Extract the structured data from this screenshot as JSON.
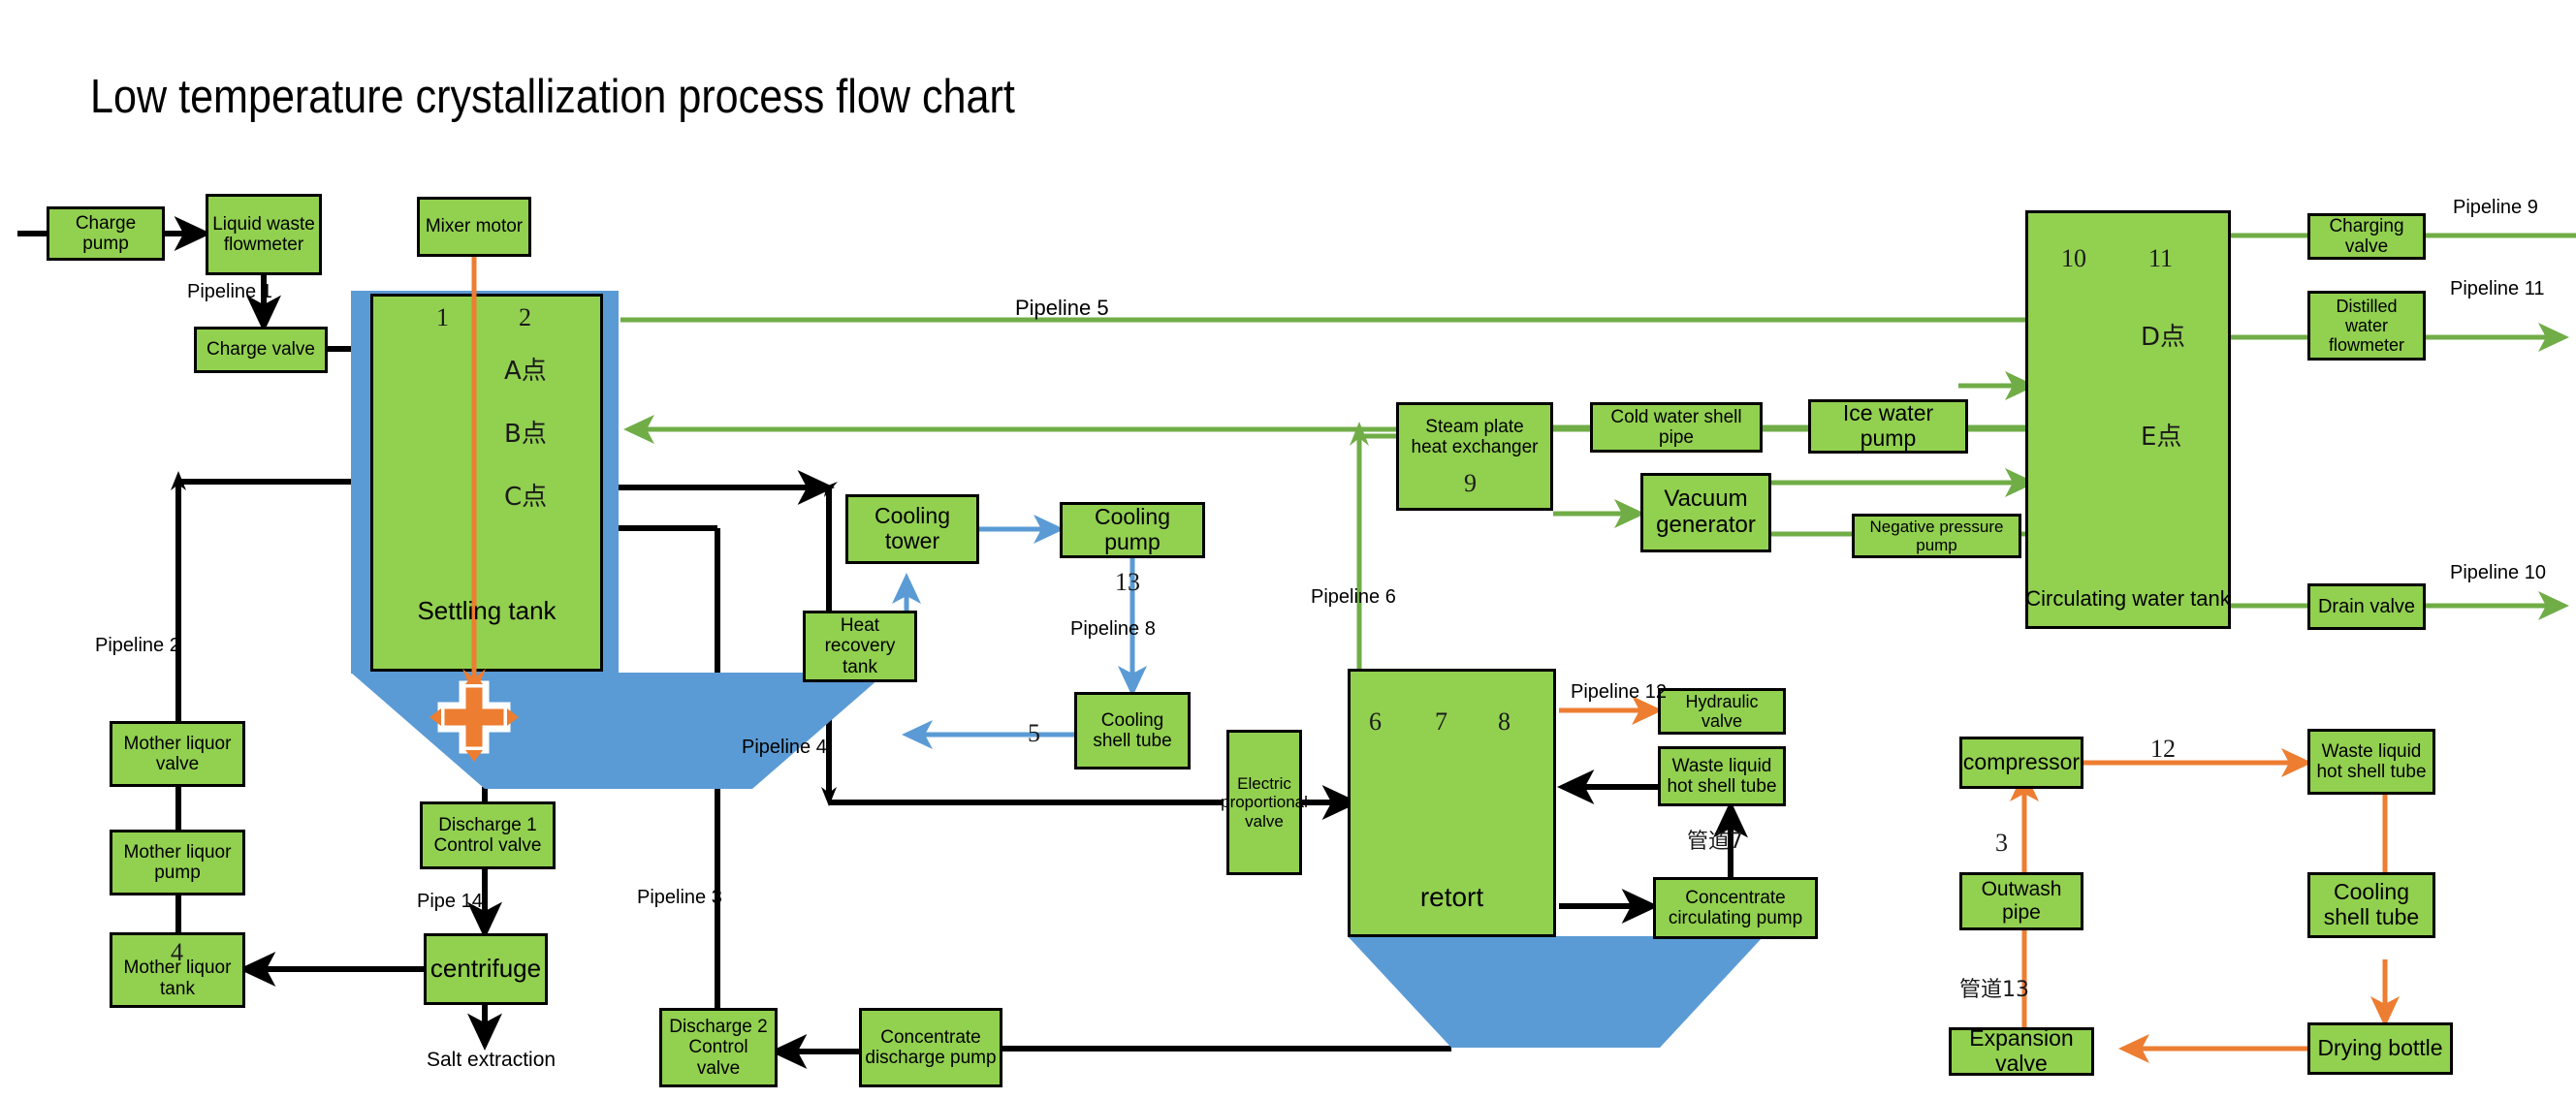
{
  "title": "Low temperature crystallization process flow chart",
  "colors": {
    "box_fill": "#92d050",
    "box_border": "#000000",
    "tank_shell": "#5b9bd5",
    "black_pipe": "#000000",
    "green_pipe": "#70ad47",
    "blue_pipe": "#5b9bd5",
    "orange_pipe": "#ed7d31",
    "background": "#ffffff"
  },
  "boxes": [
    {
      "id": "charge-pump",
      "label": "Charge pump"
    },
    {
      "id": "liquid-waste-flowmeter",
      "label": "Liquid  waste\nflowmeter"
    },
    {
      "id": "mixer-motor",
      "label": "Mixer motor"
    },
    {
      "id": "charge-valve",
      "label": "Charge valve"
    },
    {
      "id": "mother-liquor-valve",
      "label": "Mother liquor valve"
    },
    {
      "id": "mother-liquor-pump",
      "label": "Mother liquor pump"
    },
    {
      "id": "mother-liquor-tank",
      "label": "Mother liquor tank"
    },
    {
      "id": "discharge-1-control-valve",
      "label": "Discharge 1\nControl valve"
    },
    {
      "id": "centrifuge",
      "label": "centrifuge"
    },
    {
      "id": "discharge-2-control-valve",
      "label": "Discharge 2\nControl valve"
    },
    {
      "id": "concentrate-discharge-pump",
      "label": "Concentrate\ndischarge pump"
    },
    {
      "id": "cooling-tower",
      "label": "Cooling tower"
    },
    {
      "id": "cooling-pump",
      "label": "Cooling pump"
    },
    {
      "id": "heat-recovery-tank",
      "label": "Heat\nrecovery tank"
    },
    {
      "id": "cooling-shell-tube-mid",
      "label": "Cooling\nshell tube"
    },
    {
      "id": "electric-proportional-valve",
      "label": "Electric\nproportional\nvalve"
    },
    {
      "id": "steam-plate-heat-exchanger",
      "label": "Steam plate\nheat exchanger"
    },
    {
      "id": "cold-water-shell-pipe",
      "label": "Cold water shell pipe"
    },
    {
      "id": "ice-water-pump",
      "label": "Ice water pump"
    },
    {
      "id": "vacuum-generator",
      "label": "Vacuum\ngenerator"
    },
    {
      "id": "negative-pressure-pump",
      "label": "Negative pressure pump"
    },
    {
      "id": "hydraulic-valve",
      "label": "Hydraulic valve"
    },
    {
      "id": "waste-liquid-hot-shell-tube-mid",
      "label": "Waste liquid\nhot shell tube"
    },
    {
      "id": "concentrate-circulating-pump",
      "label": "Concentrate\ncirculating pump"
    },
    {
      "id": "charging-valve",
      "label": "Charging valve"
    },
    {
      "id": "distilled-water-flowmeter",
      "label": "Distilled\nwater flowmeter"
    },
    {
      "id": "drain-valve",
      "label": "Drain valve"
    },
    {
      "id": "compressor",
      "label": "compressor"
    },
    {
      "id": "waste-liquid-hot-shell-tube-r",
      "label": "Waste liquid\nhot shell tube"
    },
    {
      "id": "outwash-pipe",
      "label": "Outwash pipe"
    },
    {
      "id": "cooling-shell-tube-r",
      "label": "Cooling\nshell tube"
    },
    {
      "id": "expansion-valve",
      "label": "Expansion valve"
    },
    {
      "id": "drying-bottle",
      "label": "Drying bottle"
    }
  ],
  "vessels": {
    "settling_tank": {
      "label": "Settling tank",
      "numbers": [
        "1",
        "2"
      ],
      "points": [
        "A点",
        "B点",
        "C点"
      ]
    },
    "retort": {
      "label": "retort",
      "numbers": [
        "6",
        "7",
        "8"
      ]
    },
    "circulating_water_tank": {
      "label": "Circulating water tank",
      "numbers": [
        "10",
        "11"
      ],
      "points": [
        "D点",
        "E点"
      ]
    }
  },
  "pipeline_labels": [
    {
      "id": "pipeline-1",
      "text": "Pipeline 1"
    },
    {
      "id": "pipeline-2",
      "text": "Pipeline 2"
    },
    {
      "id": "pipeline-3",
      "text": "Pipeline 3"
    },
    {
      "id": "pipeline-4",
      "text": "Pipeline 4"
    },
    {
      "id": "pipeline-5",
      "text": "Pipeline 5"
    },
    {
      "id": "pipeline-6",
      "text": "Pipeline 6"
    },
    {
      "id": "pipeline-8",
      "text": "Pipeline 8"
    },
    {
      "id": "pipeline-9",
      "text": "Pipeline 9"
    },
    {
      "id": "pipeline-10",
      "text": "Pipeline 10"
    },
    {
      "id": "pipeline-11",
      "text": "Pipeline 11"
    },
    {
      "id": "pipeline-12",
      "text": "Pipeline 12"
    },
    {
      "id": "pipe-14",
      "text": "Pipe 14"
    },
    {
      "id": "guandao-7",
      "text": "管道7"
    },
    {
      "id": "guandao-13",
      "text": "管道13"
    }
  ],
  "number_labels": [
    {
      "id": "n-3",
      "text": "3"
    },
    {
      "id": "n-4",
      "text": "4"
    },
    {
      "id": "n-5",
      "text": "5"
    },
    {
      "id": "n-9",
      "text": "9"
    },
    {
      "id": "n-12",
      "text": "12"
    },
    {
      "id": "n-13",
      "text": "13"
    }
  ],
  "terminal_labels": [
    {
      "id": "salt-extraction",
      "text": "Salt extraction"
    }
  ]
}
